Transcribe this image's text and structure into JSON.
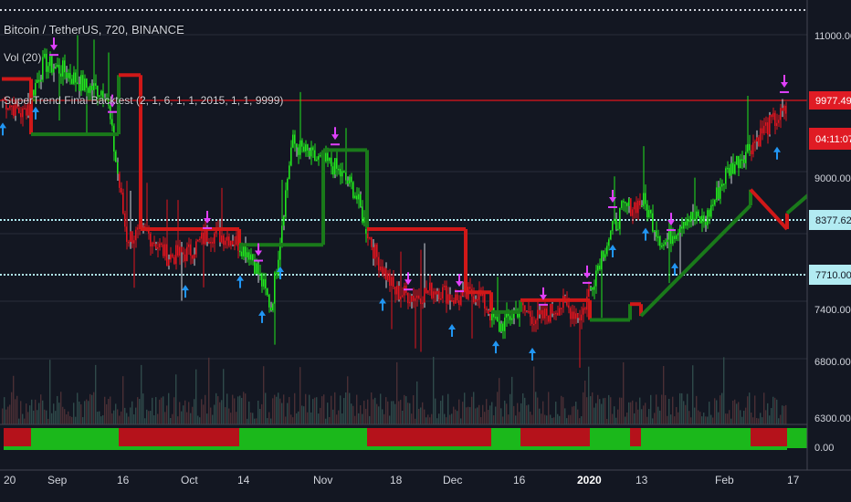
{
  "header": {
    "symbol_title": "Bitcoin / TetherUS, 720, BINANCE",
    "volume_label": "Vol (20)",
    "indicator_label": "SuperTrend Final Backtest (2, 1, 6, 1, 1, 2015, 1, 1, 9999)"
  },
  "colors": {
    "background": "#131722",
    "grid": "#2a2e39",
    "bull": "#22e61e",
    "bear": "#e0141e",
    "supertrend_bull": "#1a7a1a",
    "supertrend_bear": "#d01818",
    "volume": "#3a4a55",
    "buy_arrow": "#2196f3",
    "sell_arrow": "#e040fb",
    "price_label_bg": "#e01b24",
    "hline_label_bg": "#b2ebf2",
    "hline": "#b2ebf2"
  },
  "price_scale": {
    "ticks": [
      "11000.00",
      "9000.00",
      "7400.00",
      "6800.00",
      "6300.00",
      "0.00"
    ],
    "last_price": "9977.49",
    "countdown": "04:11:07",
    "hline_labels": [
      "8377.62",
      "7710.00"
    ]
  },
  "time_axis": {
    "labels": [
      "20",
      "Sep",
      "16",
      "Oct",
      "14",
      "Nov",
      "18",
      "Dec",
      "16",
      "2020",
      "13",
      "Feb",
      "17"
    ]
  },
  "chart_data": {
    "type": "line",
    "title": "Bitcoin / TetherUS, 720, BINANCE",
    "ylim": [
      6100,
      11300
    ],
    "grid": true,
    "series": [
      {
        "name": "SuperTrend Final Backtest",
        "values": [
          10050,
          9850,
          10500,
          10400,
          10200,
          10150,
          8300,
          8350,
          8050,
          8100,
          8350,
          8300,
          8100,
          7400,
          9500,
          9300,
          9200,
          8900,
          8100,
          7600,
          7550,
          7650,
          7500,
          7600,
          7150,
          7400,
          7250,
          7450,
          7300,
          8100,
          8650,
          8750,
          8200,
          8550,
          8500,
          9100,
          9400,
          9700,
          9900
        ]
      }
    ],
    "supertrend": [
      {
        "x": 0,
        "y": 10300,
        "dir": "bear"
      },
      {
        "x": 16,
        "y": 10300,
        "dir": "bear"
      },
      {
        "x": 16,
        "y": 9600,
        "dir": "bull"
      },
      {
        "x": 64,
        "y": 9600,
        "dir": "bull"
      },
      {
        "x": 64,
        "y": 10350,
        "dir": "bear"
      },
      {
        "x": 76,
        "y": 10350,
        "dir": "bear"
      },
      {
        "x": 76,
        "y": 8400,
        "dir": "bear"
      },
      {
        "x": 130,
        "y": 8400,
        "dir": "bear"
      },
      {
        "x": 130,
        "y": 8200,
        "dir": "bull"
      },
      {
        "x": 176,
        "y": 8200,
        "dir": "bull"
      },
      {
        "x": 176,
        "y": 9400,
        "dir": "bull"
      },
      {
        "x": 200,
        "y": 9400,
        "dir": "bull"
      },
      {
        "x": 200,
        "y": 8400,
        "dir": "bear"
      },
      {
        "x": 254,
        "y": 8400,
        "dir": "bear"
      },
      {
        "x": 254,
        "y": 7600,
        "dir": "bear"
      },
      {
        "x": 268,
        "y": 7600,
        "dir": "bear"
      },
      {
        "x": 268,
        "y": 7350,
        "dir": "bull"
      },
      {
        "x": 284,
        "y": 7350,
        "dir": "bull"
      },
      {
        "x": 284,
        "y": 7500,
        "dir": "bear"
      },
      {
        "x": 322,
        "y": 7500,
        "dir": "bear"
      },
      {
        "x": 322,
        "y": 7250,
        "dir": "bull"
      },
      {
        "x": 344,
        "y": 7250,
        "dir": "bull"
      },
      {
        "x": 344,
        "y": 7450,
        "dir": "bear"
      },
      {
        "x": 350,
        "y": 7450,
        "dir": "bear"
      },
      {
        "x": 350,
        "y": 7300,
        "dir": "bull"
      },
      {
        "x": 410,
        "y": 8700,
        "dir": "bull"
      },
      {
        "x": 410,
        "y": 8900,
        "dir": "bear"
      },
      {
        "x": 430,
        "y": 8400,
        "dir": "bear"
      },
      {
        "x": 430,
        "y": 8600,
        "dir": "bull"
      },
      {
        "x": 480,
        "y": 9600,
        "dir": "bull"
      },
      {
        "x": 480,
        "y": 10050,
        "dir": "bear"
      },
      {
        "x": 486,
        "y": 10050,
        "dir": "bear"
      }
    ],
    "buy_signals": [
      0,
      18,
      100,
      130,
      142,
      152,
      208,
      246,
      270,
      290,
      334,
      352,
      368,
      424
    ],
    "sell_signals": [
      28,
      60,
      112,
      140,
      182,
      222,
      250,
      296,
      320,
      334,
      366,
      428,
      486
    ],
    "horizontal_lines": [
      8377.62,
      7710.0
    ],
    "last_price_line": 9977.49
  }
}
